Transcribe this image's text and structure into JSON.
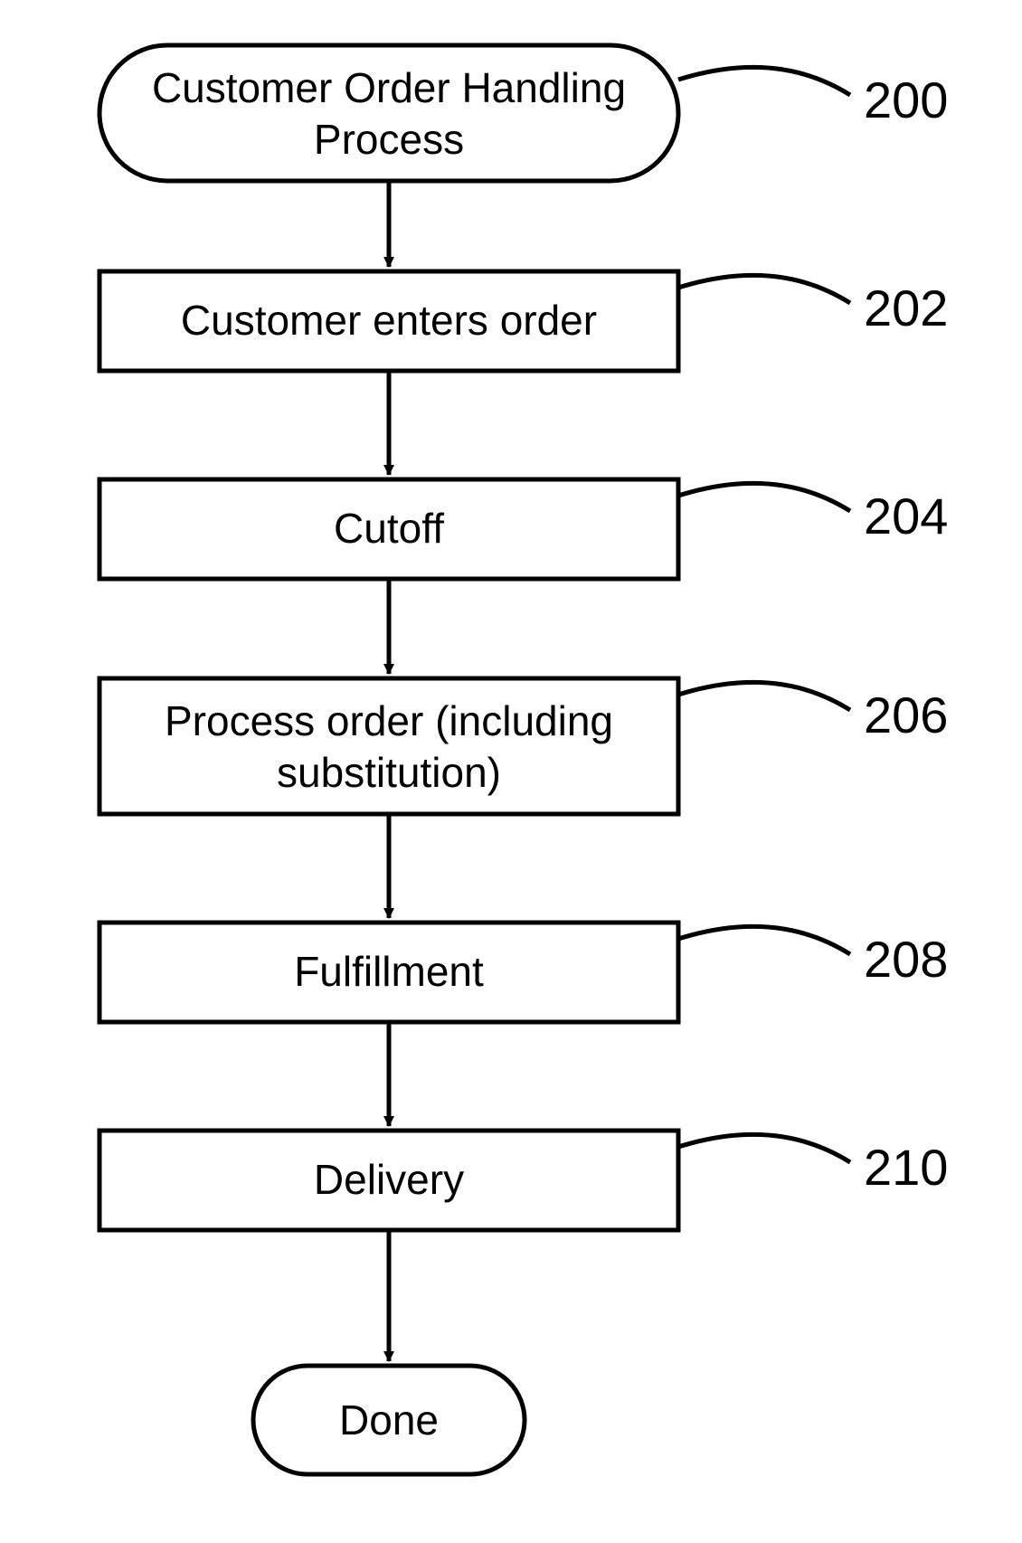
{
  "chart_data": {
    "type": "flowchart",
    "nodes": [
      {
        "id": "n200",
        "shape": "terminator",
        "text": "Customer Order Handling Process",
        "label": "200"
      },
      {
        "id": "n202",
        "shape": "process",
        "text": "Customer enters order",
        "label": "202"
      },
      {
        "id": "n204",
        "shape": "process",
        "text": "Cutoff",
        "label": "204"
      },
      {
        "id": "n206",
        "shape": "process",
        "text": "Process order (including substitution)",
        "label": "206"
      },
      {
        "id": "n208",
        "shape": "process",
        "text": "Fulfillment",
        "label": "208"
      },
      {
        "id": "n210",
        "shape": "process",
        "text": "Delivery",
        "label": "210"
      },
      {
        "id": "done",
        "shape": "terminator",
        "text": "Done",
        "label": ""
      }
    ],
    "edges": [
      [
        "n200",
        "n202"
      ],
      [
        "n202",
        "n204"
      ],
      [
        "n204",
        "n206"
      ],
      [
        "n206",
        "n208"
      ],
      [
        "n208",
        "n210"
      ],
      [
        "n210",
        "done"
      ]
    ]
  },
  "nodes": {
    "n200": {
      "line1": "Customer Order Handling",
      "line2": "Process",
      "label": "200"
    },
    "n202": {
      "text": "Customer enters order",
      "label": "202"
    },
    "n204": {
      "text": "Cutoff",
      "label": "204"
    },
    "n206": {
      "line1": "Process order (including",
      "line2": "substitution)",
      "label": "206"
    },
    "n208": {
      "text": "Fulfillment",
      "label": "208"
    },
    "n210": {
      "text": "Delivery",
      "label": "210"
    },
    "done": {
      "text": "Done"
    }
  }
}
